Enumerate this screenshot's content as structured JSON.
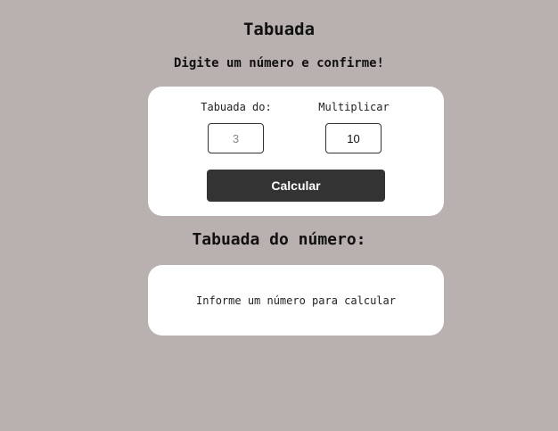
{
  "header": {
    "title": "Tabuada",
    "subtitle": "Digite um número e confirme!"
  },
  "form": {
    "table_label": "Tabuada do:",
    "table_placeholder": "3",
    "multiply_label": "Multiplicar",
    "multiply_value": "10",
    "calculate_label": "Calcular"
  },
  "result": {
    "heading": "Tabuada do número:",
    "message": "Informe um número para calcular"
  }
}
